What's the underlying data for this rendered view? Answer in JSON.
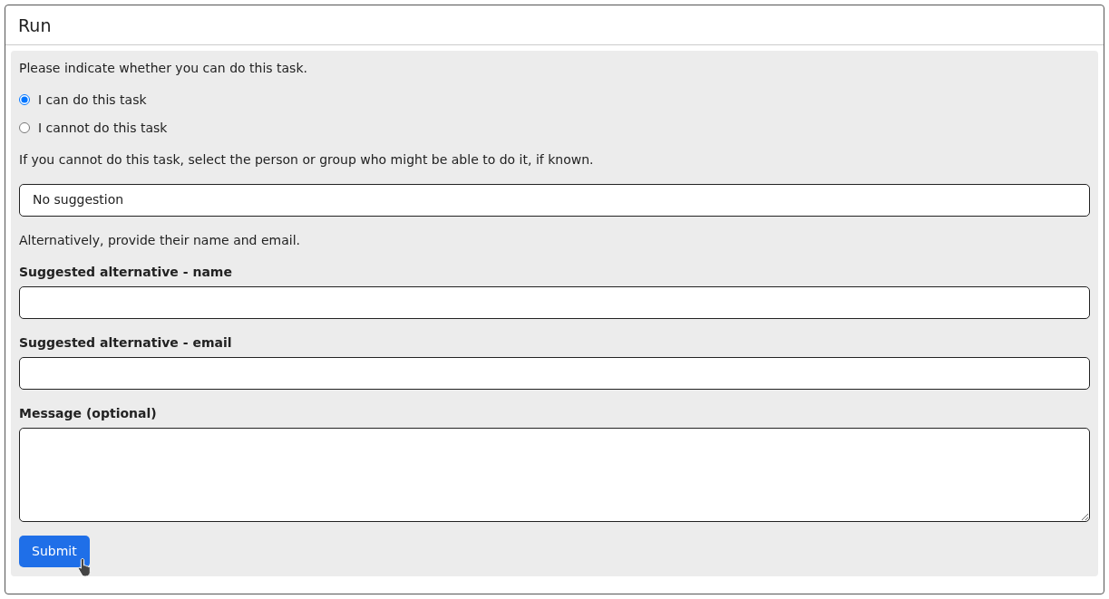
{
  "card": {
    "title": "Run"
  },
  "prompt": "Please indicate whether you can do this task.",
  "options": [
    {
      "label": "I can do this task",
      "selected": true
    },
    {
      "label": "I cannot do this task",
      "selected": false
    }
  ],
  "suggestion_prompt": "If you cannot do this task, select the person or group who might be able to do it, if known.",
  "suggestion_select": {
    "value": "No suggestion"
  },
  "alternative_prompt": "Alternatively, provide their name and email.",
  "fields": [
    {
      "label": "Suggested alternative - name",
      "kind": "input"
    },
    {
      "label": "Suggested alternative - email",
      "kind": "input"
    },
    {
      "label": "Message (optional)",
      "kind": "textarea"
    }
  ],
  "submit_button": "Submit"
}
